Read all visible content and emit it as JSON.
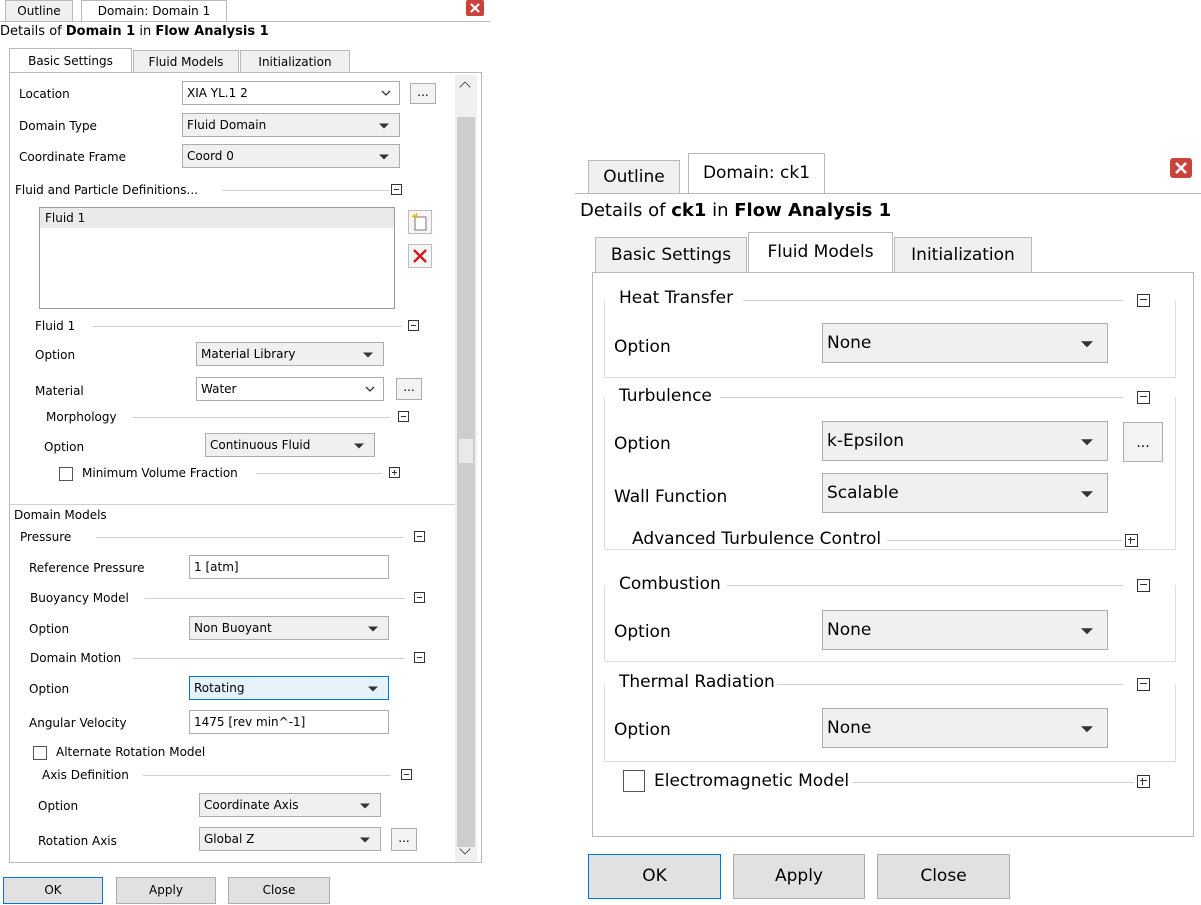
{
  "left": {
    "tabs": [
      "Outline",
      "Domain: Domain 1"
    ],
    "details_prefix": "Details of ",
    "details_object": "Domain 1",
    "details_in": " in ",
    "details_analysis": "Flow Analysis 1",
    "subtabs": [
      "Basic Settings",
      "Fluid Models",
      "Initialization"
    ],
    "location_label": "Location",
    "location_value": "XIA YL.1 2",
    "domain_type_label": "Domain Type",
    "domain_type_value": "Fluid Domain",
    "coord_label": "Coordinate Frame",
    "coord_value": "Coord 0",
    "fluid_defs_title": "Fluid and Particle Definitions...",
    "fluid_list": [
      "Fluid 1"
    ],
    "fluid1_title": "Fluid 1",
    "fluid_option_label": "Option",
    "fluid_option_value": "Material Library",
    "material_label": "Material",
    "material_value": "Water",
    "morphology_title": "Morphology",
    "morph_option_label": "Option",
    "morph_option_value": "Continuous Fluid",
    "min_vol_label": "Minimum Volume Fraction",
    "domain_models_title": "Domain Models",
    "pressure_title": "Pressure",
    "ref_pressure_label": "Reference Pressure",
    "ref_pressure_value": "1 [atm]",
    "buoyancy_title": "Buoyancy Model",
    "buoy_option_label": "Option",
    "buoy_option_value": "Non Buoyant",
    "motion_title": "Domain Motion",
    "motion_option_label": "Option",
    "motion_option_value": "Rotating",
    "ang_vel_label": "Angular Velocity",
    "ang_vel_value": "1475 [rev min^-1]",
    "alt_rot_label": "Alternate Rotation Model",
    "axis_title": "Axis Definition",
    "axis_option_label": "Option",
    "axis_option_value": "Coordinate Axis",
    "rot_axis_label": "Rotation Axis",
    "rot_axis_value": "Global Z",
    "buttons": {
      "ok": "OK",
      "apply": "Apply",
      "close": "Close"
    },
    "ellipsis": "..."
  },
  "right": {
    "tabs": [
      "Outline",
      "Domain: ck1"
    ],
    "details_prefix": "Details of ",
    "details_object": "ck1",
    "details_in": " in ",
    "details_analysis": "Flow Analysis 1",
    "subtabs": [
      "Basic Settings",
      "Fluid Models",
      "Initialization"
    ],
    "heat_title": "Heat Transfer",
    "heat_option_label": "Option",
    "heat_option_value": "None",
    "turb_title": "Turbulence",
    "turb_option_label": "Option",
    "turb_option_value": "k-Epsilon",
    "wall_label": "Wall Function",
    "wall_value": "Scalable",
    "adv_turb_label": "Advanced Turbulence Control",
    "comb_title": "Combustion",
    "comb_option_label": "Option",
    "comb_option_value": "None",
    "therm_title": "Thermal Radiation",
    "therm_option_label": "Option",
    "therm_option_value": "None",
    "em_label": "Electromagnetic Model",
    "buttons": {
      "ok": "OK",
      "apply": "Apply",
      "close": "Close"
    },
    "ellipsis": "..."
  }
}
